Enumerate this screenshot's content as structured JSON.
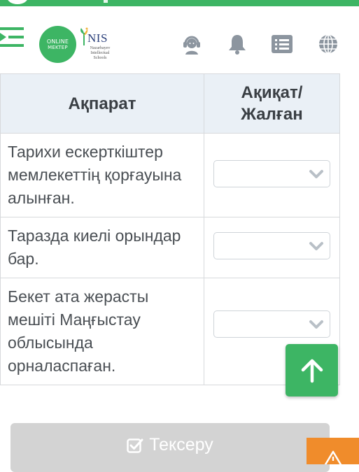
{
  "colors": {
    "brand_green": "#3db564",
    "table_header_bg": "#eaf0f6",
    "button_disabled": "#d3d3d3",
    "warning_orange": "#f08c2b"
  },
  "header": {
    "logo_line1": "ONLINE",
    "logo_line2": "MEKTEP",
    "nis_title": "NIS",
    "nis_sub1": "Nazarbayev",
    "nis_sub2": "Intellectual",
    "nis_sub3": "Schools",
    "icons": [
      "menu-icon",
      "support-headset-icon",
      "bell-icon",
      "list-icon",
      "globe-icon"
    ]
  },
  "table": {
    "col_info": "Ақпарат",
    "col_answer_line1": "Ақиқат/",
    "col_answer_line2": "Жалған",
    "rows": [
      {
        "statement": "Тарихи ескерткіштер мемлекеттің қорғауына алынған.",
        "selected": ""
      },
      {
        "statement": "Таразда киелі орындар бар.",
        "selected": ""
      },
      {
        "statement": "Бекет ата жерасты мешіті Маңғыстау облысында орналаспаған.",
        "selected": ""
      }
    ]
  },
  "actions": {
    "check_label": "Тексеру"
  }
}
